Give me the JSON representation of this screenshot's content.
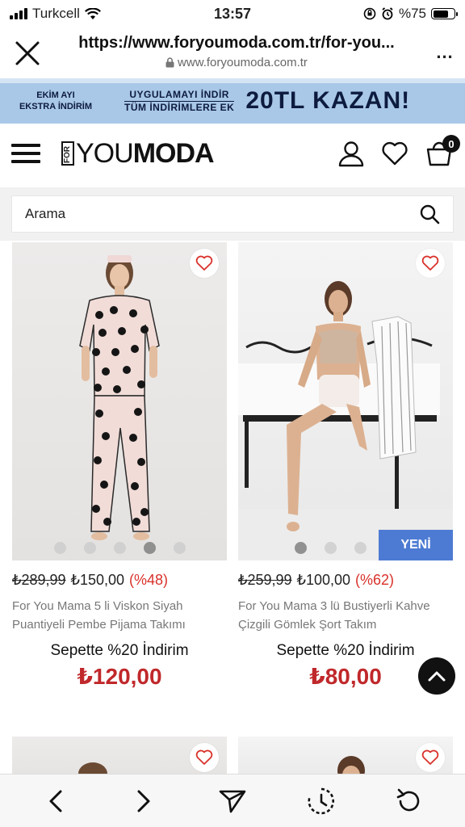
{
  "status": {
    "carrier": "Turkcell",
    "time": "13:57",
    "battery": "%75",
    "battery_level": 0.75
  },
  "browser": {
    "url": "https://www.foryoumoda.com.tr/for-you...",
    "domain": "www.foryoumoda.com.tr",
    "more": "..."
  },
  "banner": {
    "left_line1": "EKİM AYI",
    "left_line2": "EKSTRA İNDİRİM",
    "mid_line1": "UYGULAMAYI İNDİR",
    "mid_line2": "TÜM İNDİRİMLERE EK",
    "big": "20TL KAZAN!"
  },
  "header": {
    "logo_for": "FOR",
    "logo_you": "YOU",
    "logo_moda": "MODA",
    "cart_count": "0"
  },
  "search": {
    "placeholder": "Arama"
  },
  "products": [
    {
      "old_price": "₺289,99",
      "price": "₺150,00",
      "discount": "(%48)",
      "name": "For You Mama 5 li Viskon Siyah Puantiyeli Pembe Pijama Takımı",
      "basket_label": "Sepette %20 İndirim",
      "basket_price": "₺120,00",
      "image_dots": 5,
      "active_dot": 4
    },
    {
      "old_price": "₺259,99",
      "price": "₺100,00",
      "discount": "(%62)",
      "name": "For You Mama 3 lü Bustiyerli Kahve Çizgili Gömlek Şort Takım",
      "basket_label": "Sepette %20 İndirim",
      "basket_price": "₺80,00",
      "badge": "YENİ",
      "image_dots": 3,
      "active_dot": 1
    }
  ],
  "colors": {
    "accent_red": "#c0282b",
    "discount_red": "#d9312a",
    "badge_blue": "#4d7bd3",
    "banner_bg": "#a9c8e8"
  }
}
